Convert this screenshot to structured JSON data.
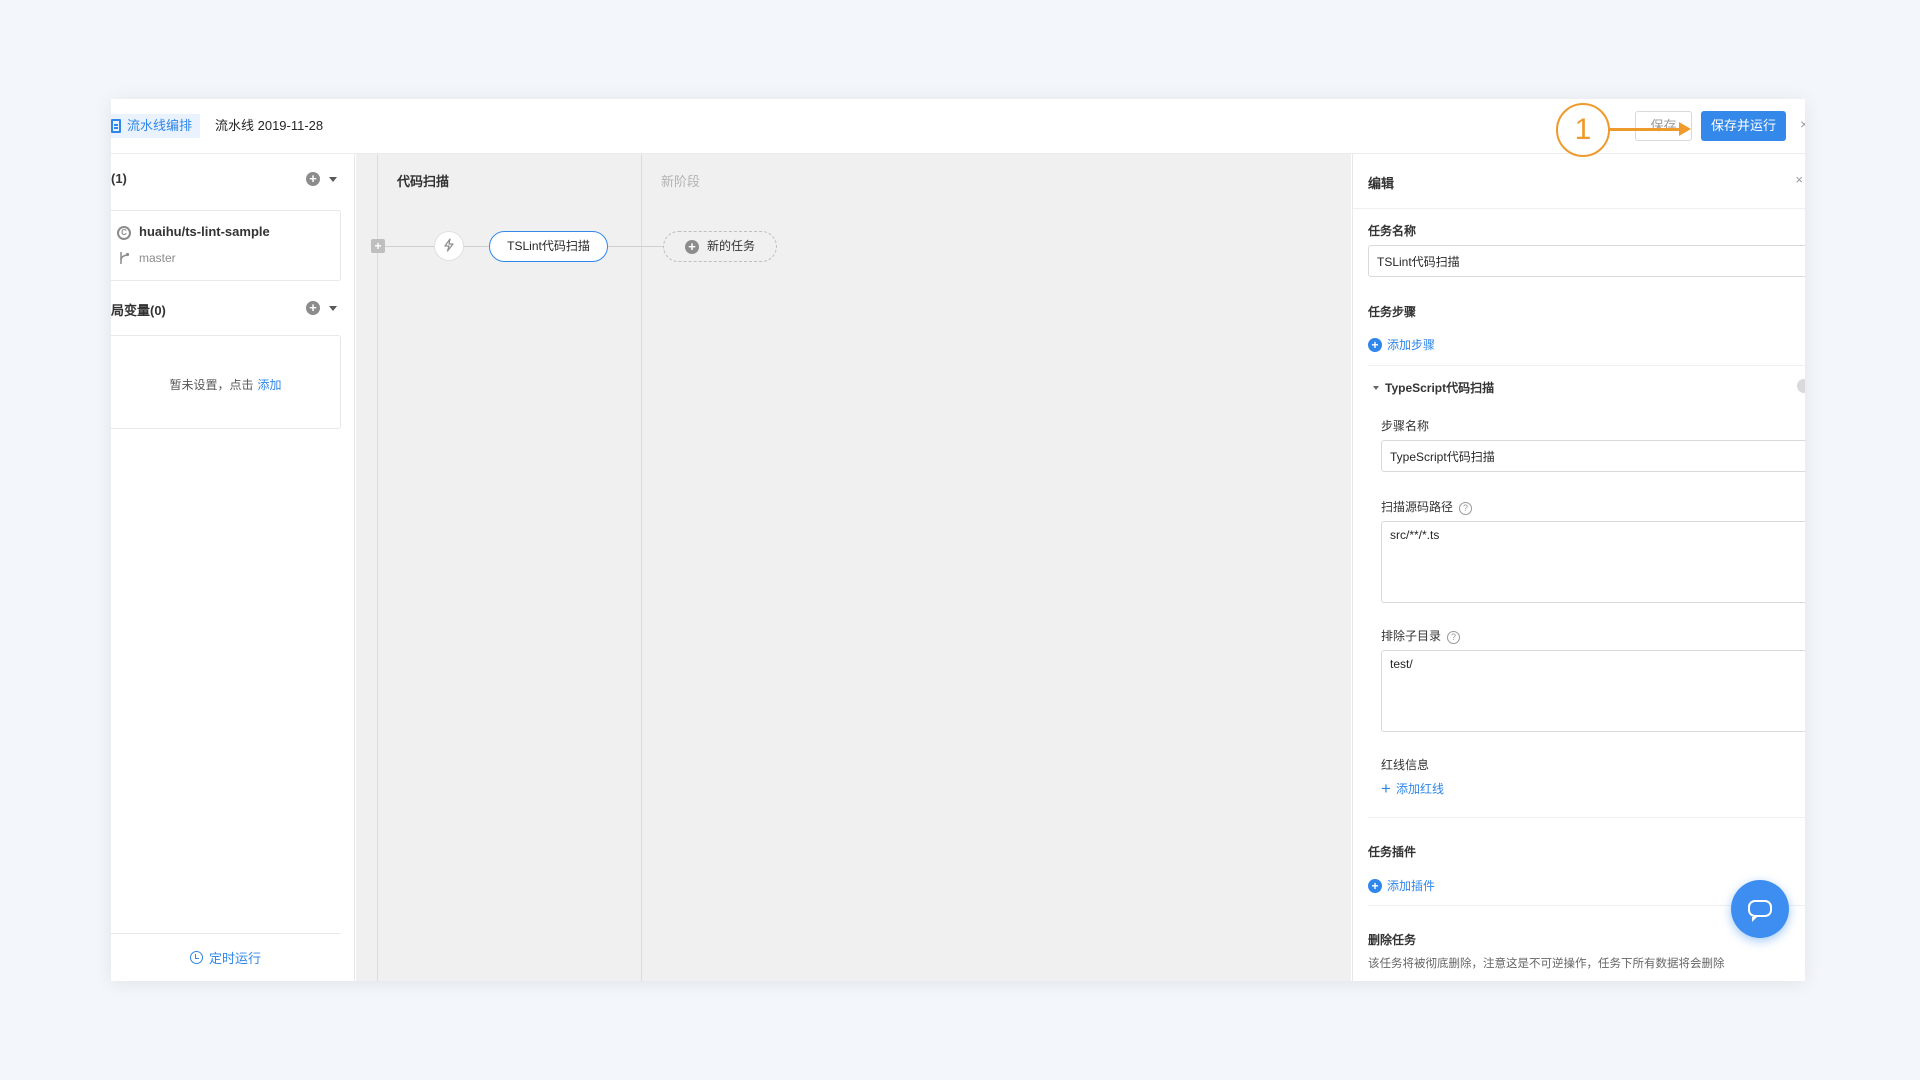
{
  "header": {
    "tab_label": "流水线编排",
    "pipeline_name": "流水线 2019-11-28",
    "save_label": "保存",
    "save_run_label": "保存并运行",
    "close_glyph": "×"
  },
  "annotation": {
    "number": "1",
    "color": "#ef9a2c"
  },
  "sidebar": {
    "sources_title": "(1)",
    "repo": {
      "name": "huaihu/ts-lint-sample",
      "branch": "master"
    },
    "vars_title": "局变量(0)",
    "vars_empty_text": "暂未设置，点击",
    "vars_add_link": "添加",
    "footer_label": "定时运行"
  },
  "canvas": {
    "stages": [
      {
        "title": "代码扫描",
        "task": "TSLint代码扫描"
      },
      {
        "title": "新阶段",
        "new_task_label": "新的任务"
      }
    ]
  },
  "panel": {
    "title": "编辑",
    "task_name_label": "任务名称",
    "task_name_value": "TSLint代码扫描",
    "steps_label": "任务步骤",
    "add_step_label": "添加步骤",
    "step": {
      "title": "TypeScript代码扫描",
      "name_label": "步骤名称",
      "name_value": "TypeScript代码扫描",
      "scan_path_label": "扫描源码路径",
      "scan_path_value": "src/**/*.ts",
      "exclude_label": "排除子目录",
      "exclude_value": "test/",
      "redline_label": "红线信息",
      "add_redline_label": "添加红线"
    },
    "plugins_label": "任务插件",
    "add_plugin_label": "添加插件",
    "delete_label": "删除任务",
    "delete_desc": "该任务将被彻底删除，注意这是不可逆操作，任务下所有数据将会删除"
  },
  "colors": {
    "accent": "#3388ea",
    "link": "#2f86eb",
    "callout": "#ef9a2c"
  }
}
